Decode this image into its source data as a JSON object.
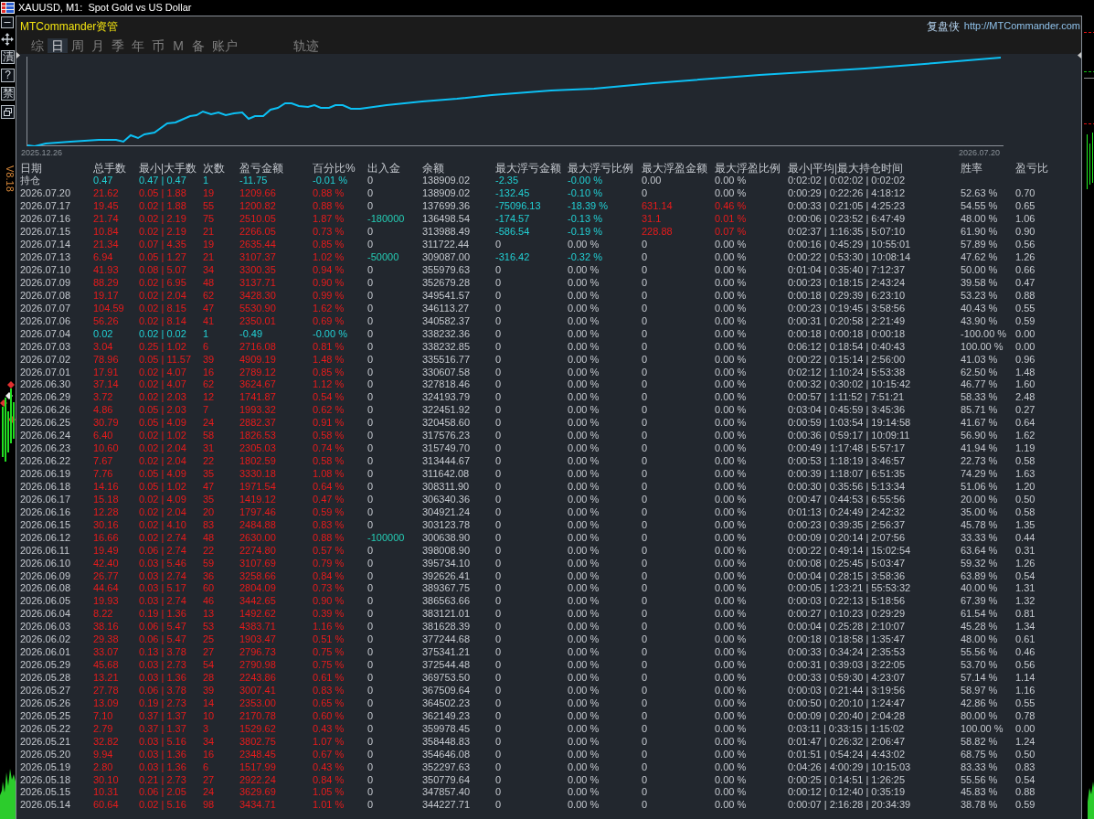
{
  "window": {
    "title": "XAUUSD, M1:  Spot Gold vs US Dollar"
  },
  "side_toolbar": [
    {
      "kind": "minimize"
    },
    {
      "kind": "move"
    },
    {
      "kind": "label",
      "text": "漬"
    },
    {
      "kind": "label",
      "text": "?"
    },
    {
      "kind": "label",
      "text": "禁"
    },
    {
      "kind": "restore"
    }
  ],
  "version": "V8.18",
  "panel": {
    "brand": "MTCommander资管",
    "tagline": "复盘侠",
    "url": "http://MTCommander.com",
    "tabs": [
      {
        "label": "综",
        "selected": false
      },
      {
        "label": "日",
        "selected": true
      },
      {
        "label": "周",
        "selected": false
      },
      {
        "label": "月",
        "selected": false
      },
      {
        "label": "季",
        "selected": false
      },
      {
        "label": "年",
        "selected": false
      },
      {
        "label": "币",
        "selected": false
      },
      {
        "label": "M",
        "selected": false
      },
      {
        "label": "备",
        "selected": false
      },
      {
        "label": "账户",
        "selected": false
      }
    ],
    "trail_button": {
      "label": "轨迹"
    },
    "chart": {
      "start_label": "2025.12.26",
      "end_label": "2026.07.20"
    },
    "table": {
      "columns": [
        "日期",
        "总手数",
        "最小|大手数",
        "次数",
        "盈亏金额",
        "百分比%",
        "出入金",
        "余额",
        "最大浮亏金额",
        "最大浮亏比例",
        "最大浮盈金额",
        "最大浮盈比例",
        "最小|平均|最大持仓时间",
        "胜率",
        "盈亏比"
      ],
      "rows": [
        {
          "cells": [
            "持仓",
            "0.47",
            "0.47 | 0.47",
            "1",
            "-11.75",
            "-0.01 %",
            "0",
            "138909.02",
            "-2.35",
            "-0.00 %",
            "0.00",
            "0.00 %",
            "0:02:02 | 0:02:02 | 0:02:02"
          ],
          "loss": true,
          "cash_flow": false,
          "float_loss": true,
          "float_profit": false
        },
        {
          "cells": [
            "2026.07.20",
            "21.62",
            "0.05 | 1.88",
            "19",
            "1209.66",
            "0.88 %",
            "0",
            "138909.02",
            "-132.45",
            "-0.10 %",
            "0",
            "0.00 %",
            "0:00:29 | 0:22:26 | 4:18:12",
            "52.63 %",
            "0.70"
          ],
          "loss": false,
          "cash_flow": false,
          "float_loss": true,
          "float_profit": false
        },
        {
          "cells": [
            "2026.07.17",
            "19.45",
            "0.02 | 1.88",
            "55",
            "1200.82",
            "0.88 %",
            "0",
            "137699.36",
            "-75096.13",
            "-18.39 %",
            "631.14",
            "0.46 %",
            "0:00:33 | 0:21:05 | 4:25:23",
            "54.55 %",
            "0.65"
          ],
          "loss": false,
          "cash_flow": false,
          "float_loss": true,
          "float_profit": true
        },
        {
          "cells": [
            "2026.07.16",
            "21.74",
            "0.02 | 2.19",
            "75",
            "2510.05",
            "1.87 %",
            "-180000",
            "136498.54",
            "-174.57",
            "-0.13 %",
            "31.1",
            "0.01 %",
            "0:00:06 | 0:23:52 | 6:47:49",
            "48.00 %",
            "1.06"
          ],
          "loss": false,
          "cash_flow": true,
          "float_loss": true,
          "float_profit": true
        },
        {
          "cells": [
            "2026.07.15",
            "10.84",
            "0.02 | 2.19",
            "21",
            "2266.05",
            "0.73 %",
            "0",
            "313988.49",
            "-586.54",
            "-0.19 %",
            "228.88",
            "0.07 %",
            "0:02:37 | 1:16:35 | 5:07:10",
            "61.90 %",
            "0.90"
          ],
          "loss": false,
          "cash_flow": false,
          "float_loss": true,
          "float_profit": true
        },
        {
          "cells": [
            "2026.07.14",
            "21.34",
            "0.07 | 4.35",
            "19",
            "2635.44",
            "0.85 %",
            "0",
            "311722.44",
            "0",
            "0.00 %",
            "0",
            "0.00 %",
            "0:00:16 | 0:45:29 | 10:55:01",
            "57.89 %",
            "0.56"
          ],
          "loss": false,
          "cash_flow": false,
          "float_loss": false,
          "float_profit": false
        },
        {
          "cells": [
            "2026.07.13",
            "6.94",
            "0.05 | 1.27",
            "21",
            "3107.37",
            "1.02 %",
            "-50000",
            "309087.00",
            "-316.42",
            "-0.32 %",
            "0",
            "0.00 %",
            "0:00:22 | 0:53:30 | 10:08:14",
            "47.62 %",
            "1.26"
          ],
          "loss": false,
          "cash_flow": true,
          "float_loss": true,
          "float_profit": false
        },
        {
          "cells": [
            "2026.07.10",
            "41.93",
            "0.08 | 5.07",
            "34",
            "3300.35",
            "0.94 %",
            "0",
            "355979.63",
            "0",
            "0.00 %",
            "0",
            "0.00 %",
            "0:01:04 | 0:35:40 | 7:12:37",
            "50.00 %",
            "0.66"
          ],
          "loss": false,
          "cash_flow": false,
          "float_loss": false,
          "float_profit": false
        },
        {
          "cells": [
            "2026.07.09",
            "88.29",
            "0.02 | 6.95",
            "48",
            "3137.71",
            "0.90 %",
            "0",
            "352679.28",
            "0",
            "0.00 %",
            "0",
            "0.00 %",
            "0:00:23 | 0:18:15 | 2:43:24",
            "39.58 %",
            "0.47"
          ],
          "loss": false,
          "cash_flow": false,
          "float_loss": false,
          "float_profit": false
        },
        {
          "cells": [
            "2026.07.08",
            "19.17",
            "0.02 | 2.04",
            "62",
            "3428.30",
            "0.99 %",
            "0",
            "349541.57",
            "0",
            "0.00 %",
            "0",
            "0.00 %",
            "0:00:18 | 0:29:39 | 6:23:10",
            "53.23 %",
            "0.88"
          ],
          "loss": false,
          "cash_flow": false,
          "float_loss": false,
          "float_profit": false
        },
        {
          "cells": [
            "2026.07.07",
            "104.59",
            "0.02 | 8.15",
            "47",
            "5530.90",
            "1.62 %",
            "0",
            "346113.27",
            "0",
            "0.00 %",
            "0",
            "0.00 %",
            "0:00:23 | 0:19:45 | 3:58:56",
            "40.43 %",
            "0.55"
          ],
          "loss": false,
          "cash_flow": false,
          "float_loss": false,
          "float_profit": false
        },
        {
          "cells": [
            "2026.07.06",
            "56.26",
            "0.02 | 8.14",
            "41",
            "2350.01",
            "0.69 %",
            "0",
            "340582.37",
            "0",
            "0.00 %",
            "0",
            "0.00 %",
            "0:00:31 | 0:20:58 | 2:21:49",
            "43.90 %",
            "0.59"
          ],
          "loss": false,
          "cash_flow": false,
          "float_loss": false,
          "float_profit": false
        },
        {
          "cells": [
            "2026.07.04",
            "0.02",
            "0.02 | 0.02",
            "1",
            "-0.49",
            "-0.00 %",
            "0",
            "338232.36",
            "0",
            "0.00 %",
            "0",
            "0.00 %",
            "0:00:18 | 0:00:18 | 0:00:18",
            "-100.00 %",
            "0.00"
          ],
          "loss": true,
          "cash_flow": false,
          "float_loss": false,
          "float_profit": false
        },
        {
          "cells": [
            "2026.07.03",
            "3.04",
            "0.25 | 1.02",
            "6",
            "2716.08",
            "0.81 %",
            "0",
            "338232.85",
            "0",
            "0.00 %",
            "0",
            "0.00 %",
            "0:06:12 | 0:18:54 | 0:40:43",
            "100.00 %",
            "0.00"
          ],
          "loss": false,
          "cash_flow": false,
          "float_loss": false,
          "float_profit": false
        },
        {
          "cells": [
            "2026.07.02",
            "78.96",
            "0.05 | 11.57",
            "39",
            "4909.19",
            "1.48 %",
            "0",
            "335516.77",
            "0",
            "0.00 %",
            "0",
            "0.00 %",
            "0:00:22 | 0:15:14 | 2:56:00",
            "41.03 %",
            "0.96"
          ],
          "loss": false,
          "cash_flow": false,
          "float_loss": false,
          "float_profit": false
        },
        {
          "cells": [
            "2026.07.01",
            "17.91",
            "0.02 | 4.07",
            "16",
            "2789.12",
            "0.85 %",
            "0",
            "330607.58",
            "0",
            "0.00 %",
            "0",
            "0.00 %",
            "0:02:12 | 1:10:24 | 5:53:38",
            "62.50 %",
            "1.48"
          ],
          "loss": false,
          "cash_flow": false,
          "float_loss": false,
          "float_profit": false
        },
        {
          "cells": [
            "2026.06.30",
            "37.14",
            "0.02 | 4.07",
            "62",
            "3624.67",
            "1.12 %",
            "0",
            "327818.46",
            "0",
            "0.00 %",
            "0",
            "0.00 %",
            "0:00:32 | 0:30:02 | 10:15:42",
            "46.77 %",
            "1.60"
          ],
          "loss": false,
          "cash_flow": false,
          "float_loss": false,
          "float_profit": false
        },
        {
          "cells": [
            "2026.06.29",
            "3.72",
            "0.02 | 2.03",
            "12",
            "1741.87",
            "0.54 %",
            "0",
            "324193.79",
            "0",
            "0.00 %",
            "0",
            "0.00 %",
            "0:00:57 | 1:11:52 | 7:51:21",
            "58.33 %",
            "2.48"
          ],
          "loss": false,
          "cash_flow": false,
          "float_loss": false,
          "float_profit": false
        },
        {
          "cells": [
            "2026.06.26",
            "4.86",
            "0.05 | 2.03",
            "7",
            "1993.32",
            "0.62 %",
            "0",
            "322451.92",
            "0",
            "0.00 %",
            "0",
            "0.00 %",
            "0:03:04 | 0:45:59 | 3:45:36",
            "85.71 %",
            "0.27"
          ],
          "loss": false,
          "cash_flow": false,
          "float_loss": false,
          "float_profit": false
        },
        {
          "cells": [
            "2026.06.25",
            "30.79",
            "0.05 | 4.09",
            "24",
            "2882.37",
            "0.91 %",
            "0",
            "320458.60",
            "0",
            "0.00 %",
            "0",
            "0.00 %",
            "0:00:59 | 1:03:54 | 19:14:58",
            "41.67 %",
            "0.64"
          ],
          "loss": false,
          "cash_flow": false,
          "float_loss": false,
          "float_profit": false
        },
        {
          "cells": [
            "2026.06.24",
            "6.40",
            "0.02 | 1.02",
            "58",
            "1826.53",
            "0.58 %",
            "0",
            "317576.23",
            "0",
            "0.00 %",
            "0",
            "0.00 %",
            "0:00:36 | 0:59:17 | 10:09:11",
            "56.90 %",
            "1.62"
          ],
          "loss": false,
          "cash_flow": false,
          "float_loss": false,
          "float_profit": false
        },
        {
          "cells": [
            "2026.06.23",
            "10.60",
            "0.02 | 2.04",
            "31",
            "2305.03",
            "0.74 %",
            "0",
            "315749.70",
            "0",
            "0.00 %",
            "0",
            "0.00 %",
            "0:00:49 | 1:17:48 | 5:57:17",
            "41.94 %",
            "1.19"
          ],
          "loss": false,
          "cash_flow": false,
          "float_loss": false,
          "float_profit": false
        },
        {
          "cells": [
            "2026.06.22",
            "7.67",
            "0.02 | 2.04",
            "22",
            "1802.59",
            "0.58 %",
            "0",
            "313444.67",
            "0",
            "0.00 %",
            "0",
            "0.00 %",
            "0:00:53 | 1:18:19 | 3:46:57",
            "22.73 %",
            "0.58"
          ],
          "loss": false,
          "cash_flow": false,
          "float_loss": false,
          "float_profit": false
        },
        {
          "cells": [
            "2026.06.19",
            "7.76",
            "0.05 | 4.09",
            "35",
            "3330.18",
            "1.08 %",
            "0",
            "311642.08",
            "0",
            "0.00 %",
            "0",
            "0.00 %",
            "0:00:39 | 1:18:07 | 6:51:35",
            "74.29 %",
            "1.63"
          ],
          "loss": false,
          "cash_flow": false,
          "float_loss": false,
          "float_profit": false
        },
        {
          "cells": [
            "2026.06.18",
            "14.16",
            "0.05 | 1.02",
            "47",
            "1971.54",
            "0.64 %",
            "0",
            "308311.90",
            "0",
            "0.00 %",
            "0",
            "0.00 %",
            "0:00:30 | 0:35:56 | 5:13:34",
            "51.06 %",
            "1.20"
          ],
          "loss": false,
          "cash_flow": false,
          "float_loss": false,
          "float_profit": false
        },
        {
          "cells": [
            "2026.06.17",
            "15.18",
            "0.02 | 4.09",
            "35",
            "1419.12",
            "0.47 %",
            "0",
            "306340.36",
            "0",
            "0.00 %",
            "0",
            "0.00 %",
            "0:00:47 | 0:44:53 | 6:55:56",
            "20.00 %",
            "0.50"
          ],
          "loss": false,
          "cash_flow": false,
          "float_loss": false,
          "float_profit": false
        },
        {
          "cells": [
            "2026.06.16",
            "12.28",
            "0.02 | 2.04",
            "20",
            "1797.46",
            "0.59 %",
            "0",
            "304921.24",
            "0",
            "0.00 %",
            "0",
            "0.00 %",
            "0:01:13 | 0:24:49 | 2:42:32",
            "35.00 %",
            "0.58"
          ],
          "loss": false,
          "cash_flow": false,
          "float_loss": false,
          "float_profit": false
        },
        {
          "cells": [
            "2026.06.15",
            "30.16",
            "0.02 | 4.10",
            "83",
            "2484.88",
            "0.83 %",
            "0",
            "303123.78",
            "0",
            "0.00 %",
            "0",
            "0.00 %",
            "0:00:23 | 0:39:35 | 2:56:37",
            "45.78 %",
            "1.35"
          ],
          "loss": false,
          "cash_flow": false,
          "float_loss": false,
          "float_profit": false
        },
        {
          "cells": [
            "2026.06.12",
            "16.66",
            "0.02 | 2.74",
            "48",
            "2630.00",
            "0.88 %",
            "-100000",
            "300638.90",
            "0",
            "0.00 %",
            "0",
            "0.00 %",
            "0:00:09 | 0:20:14 | 2:07:56",
            "33.33 %",
            "0.44"
          ],
          "loss": false,
          "cash_flow": true,
          "float_loss": false,
          "float_profit": false
        },
        {
          "cells": [
            "2026.06.11",
            "19.49",
            "0.06 | 2.74",
            "22",
            "2274.80",
            "0.57 %",
            "0",
            "398008.90",
            "0",
            "0.00 %",
            "0",
            "0.00 %",
            "0:00:22 | 0:49:14 | 15:02:54",
            "63.64 %",
            "0.31"
          ],
          "loss": false,
          "cash_flow": false,
          "float_loss": false,
          "float_profit": false
        },
        {
          "cells": [
            "2026.06.10",
            "42.40",
            "0.03 | 5.46",
            "59",
            "3107.69",
            "0.79 %",
            "0",
            "395734.10",
            "0",
            "0.00 %",
            "0",
            "0.00 %",
            "0:00:08 | 0:25:45 | 5:03:47",
            "59.32 %",
            "1.26"
          ],
          "loss": false,
          "cash_flow": false,
          "float_loss": false,
          "float_profit": false
        },
        {
          "cells": [
            "2026.06.09",
            "26.77",
            "0.03 | 2.74",
            "36",
            "3258.66",
            "0.84 %",
            "0",
            "392626.41",
            "0",
            "0.00 %",
            "0",
            "0.00 %",
            "0:00:04 | 0:28:15 | 3:58:36",
            "63.89 %",
            "0.54"
          ],
          "loss": false,
          "cash_flow": false,
          "float_loss": false,
          "float_profit": false
        },
        {
          "cells": [
            "2026.06.08",
            "44.64",
            "0.03 | 5.17",
            "60",
            "2804.09",
            "0.73 %",
            "0",
            "389367.75",
            "0",
            "0.00 %",
            "0",
            "0.00 %",
            "0:00:05 | 1:23:21 | 55:53:32",
            "40.00 %",
            "1.31"
          ],
          "loss": false,
          "cash_flow": false,
          "float_loss": false,
          "float_profit": false
        },
        {
          "cells": [
            "2026.06.05",
            "19.93",
            "0.03 | 2.74",
            "46",
            "3442.65",
            "0.90 %",
            "0",
            "386563.66",
            "0",
            "0.00 %",
            "0",
            "0.00 %",
            "0:00:03 | 0:22:13 | 5:18:56",
            "67.39 %",
            "1.32"
          ],
          "loss": false,
          "cash_flow": false,
          "float_loss": false,
          "float_profit": false
        },
        {
          "cells": [
            "2026.06.04",
            "8.22",
            "0.19 | 1.36",
            "13",
            "1492.62",
            "0.39 %",
            "0",
            "383121.01",
            "0",
            "0.00 %",
            "0",
            "0.00 %",
            "0:00:27 | 0:10:23 | 0:29:29",
            "61.54 %",
            "0.81"
          ],
          "loss": false,
          "cash_flow": false,
          "float_loss": false,
          "float_profit": false
        },
        {
          "cells": [
            "2026.06.03",
            "38.16",
            "0.06 | 5.47",
            "53",
            "4383.71",
            "1.16 %",
            "0",
            "381628.39",
            "0",
            "0.00 %",
            "0",
            "0.00 %",
            "0:00:04 | 0:25:28 | 2:10:07",
            "45.28 %",
            "1.34"
          ],
          "loss": false,
          "cash_flow": false,
          "float_loss": false,
          "float_profit": false
        },
        {
          "cells": [
            "2026.06.02",
            "29.38",
            "0.06 | 5.47",
            "25",
            "1903.47",
            "0.51 %",
            "0",
            "377244.68",
            "0",
            "0.00 %",
            "0",
            "0.00 %",
            "0:00:18 | 0:18:58 | 1:35:47",
            "48.00 %",
            "0.61"
          ],
          "loss": false,
          "cash_flow": false,
          "float_loss": false,
          "float_profit": false
        },
        {
          "cells": [
            "2026.06.01",
            "33.07",
            "0.13 | 3.78",
            "27",
            "2796.73",
            "0.75 %",
            "0",
            "375341.21",
            "0",
            "0.00 %",
            "0",
            "0.00 %",
            "0:00:33 | 0:34:24 | 2:35:53",
            "55.56 %",
            "0.46"
          ],
          "loss": false,
          "cash_flow": false,
          "float_loss": false,
          "float_profit": false
        },
        {
          "cells": [
            "2026.05.29",
            "45.68",
            "0.03 | 2.73",
            "54",
            "2790.98",
            "0.75 %",
            "0",
            "372544.48",
            "0",
            "0.00 %",
            "0",
            "0.00 %",
            "0:00:31 | 0:39:03 | 3:22:05",
            "53.70 %",
            "0.56"
          ],
          "loss": false,
          "cash_flow": false,
          "float_loss": false,
          "float_profit": false
        },
        {
          "cells": [
            "2026.05.28",
            "13.21",
            "0.03 | 1.36",
            "28",
            "2243.86",
            "0.61 %",
            "0",
            "369753.50",
            "0",
            "0.00 %",
            "0",
            "0.00 %",
            "0:00:33 | 0:59:30 | 4:23:07",
            "57.14 %",
            "1.14"
          ],
          "loss": false,
          "cash_flow": false,
          "float_loss": false,
          "float_profit": false
        },
        {
          "cells": [
            "2026.05.27",
            "27.78",
            "0.06 | 3.78",
            "39",
            "3007.41",
            "0.83 %",
            "0",
            "367509.64",
            "0",
            "0.00 %",
            "0",
            "0.00 %",
            "0:00:03 | 0:21:44 | 3:19:56",
            "58.97 %",
            "1.16"
          ],
          "loss": false,
          "cash_flow": false,
          "float_loss": false,
          "float_profit": false
        },
        {
          "cells": [
            "2026.05.26",
            "13.09",
            "0.19 | 2.73",
            "14",
            "2353.00",
            "0.65 %",
            "0",
            "364502.23",
            "0",
            "0.00 %",
            "0",
            "0.00 %",
            "0:00:50 | 0:20:10 | 1:24:47",
            "42.86 %",
            "0.55"
          ],
          "loss": false,
          "cash_flow": false,
          "float_loss": false,
          "float_profit": false
        },
        {
          "cells": [
            "2026.05.25",
            "7.10",
            "0.37 | 1.37",
            "10",
            "2170.78",
            "0.60 %",
            "0",
            "362149.23",
            "0",
            "0.00 %",
            "0",
            "0.00 %",
            "0:00:09 | 0:20:40 | 2:04:28",
            "80.00 %",
            "0.78"
          ],
          "loss": false,
          "cash_flow": false,
          "float_loss": false,
          "float_profit": false
        },
        {
          "cells": [
            "2026.05.22",
            "2.79",
            "0.37 | 1.37",
            "3",
            "1529.62",
            "0.43 %",
            "0",
            "359978.45",
            "0",
            "0.00 %",
            "0",
            "0.00 %",
            "0:03:11 | 0:33:15 | 1:15:02",
            "100.00 %",
            "0.00"
          ],
          "loss": false,
          "cash_flow": false,
          "float_loss": false,
          "float_profit": false
        },
        {
          "cells": [
            "2026.05.21",
            "32.82",
            "0.03 | 5.16",
            "34",
            "3802.75",
            "1.07 %",
            "0",
            "358448.83",
            "0",
            "0.00 %",
            "0",
            "0.00 %",
            "0:01:47 | 0:26:32 | 2:06:47",
            "58.82 %",
            "1.24"
          ],
          "loss": false,
          "cash_flow": false,
          "float_loss": false,
          "float_profit": false
        },
        {
          "cells": [
            "2026.05.20",
            "9.94",
            "0.03 | 1.36",
            "16",
            "2348.45",
            "0.67 %",
            "0",
            "354646.08",
            "0",
            "0.00 %",
            "0",
            "0.00 %",
            "0:01:51 | 0:54:24 | 4:43:02",
            "68.75 %",
            "0.50"
          ],
          "loss": false,
          "cash_flow": false,
          "float_loss": false,
          "float_profit": false
        },
        {
          "cells": [
            "2026.05.19",
            "2.80",
            "0.03 | 1.36",
            "6",
            "1517.99",
            "0.43 %",
            "0",
            "352297.63",
            "0",
            "0.00 %",
            "0",
            "0.00 %",
            "0:04:26 | 4:00:29 | 10:15:03",
            "83.33 %",
            "0.83"
          ],
          "loss": false,
          "cash_flow": false,
          "float_loss": false,
          "float_profit": false
        },
        {
          "cells": [
            "2026.05.18",
            "30.10",
            "0.21 | 2.73",
            "27",
            "2922.24",
            "0.84 %",
            "0",
            "350779.64",
            "0",
            "0.00 %",
            "0",
            "0.00 %",
            "0:00:25 | 0:14:51 | 1:26:25",
            "55.56 %",
            "0.54"
          ],
          "loss": false,
          "cash_flow": false,
          "float_loss": false,
          "float_profit": false
        },
        {
          "cells": [
            "2026.05.15",
            "10.31",
            "0.06 | 2.05",
            "24",
            "3629.69",
            "1.05 %",
            "0",
            "347857.40",
            "0",
            "0.00 %",
            "0",
            "0.00 %",
            "0:00:12 | 0:12:40 | 0:35:19",
            "45.83 %",
            "0.88"
          ],
          "loss": false,
          "cash_flow": false,
          "float_loss": false,
          "float_profit": false
        },
        {
          "cells": [
            "2026.05.14",
            "60.64",
            "0.02 | 5.16",
            "98",
            "3434.71",
            "1.01 %",
            "0",
            "344227.71",
            "0",
            "0.00 %",
            "0",
            "0.00 %",
            "0:00:07 | 2:16:28 | 20:34:39",
            "38.78 %",
            "0.59"
          ],
          "loss": false,
          "cash_flow": false,
          "float_loss": false,
          "float_profit": false
        }
      ]
    }
  }
}
